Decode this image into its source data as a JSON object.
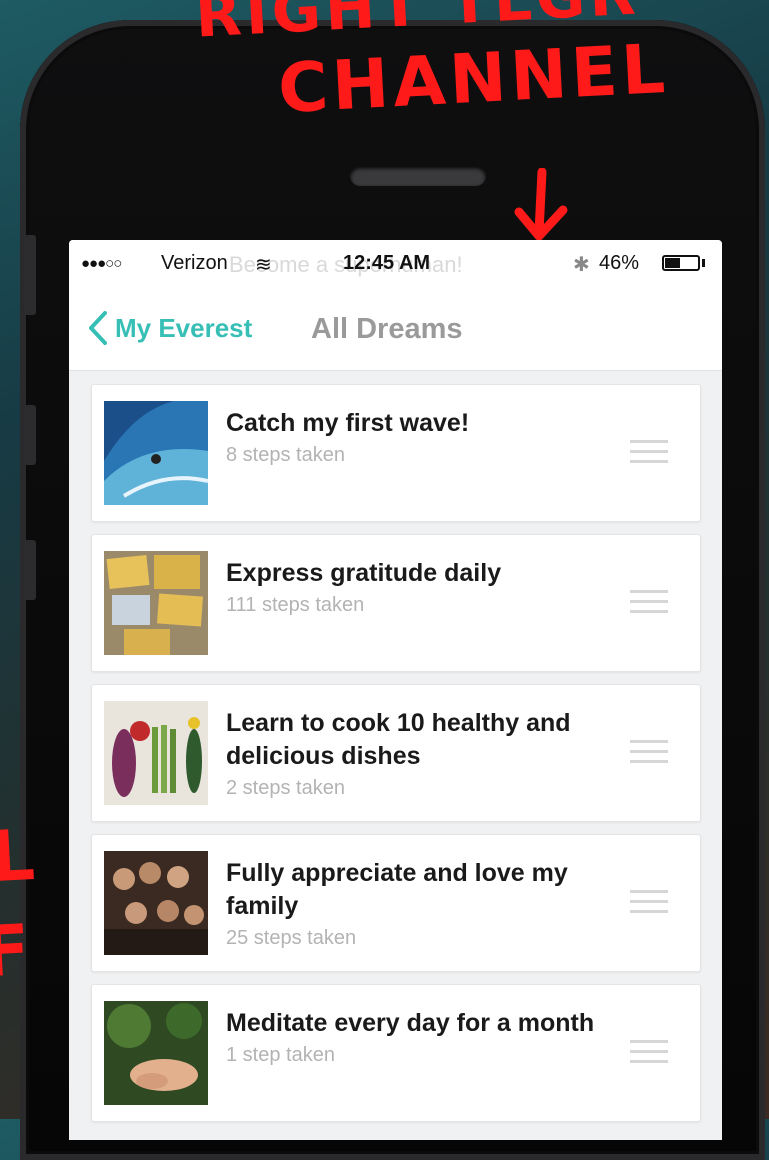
{
  "annotation": {
    "line1": "RIGHT TLGR",
    "line2": "CHANNEL",
    "left_mark_1": "L",
    "left_mark_2": "F",
    "color": "#ff1a1a"
  },
  "status_bar": {
    "signal": "●●●○○",
    "carrier": "Verizon",
    "wifi": "≋",
    "time": "12:45 AM",
    "bluetooth": "✱",
    "battery_percent": "46%",
    "battery_level": 0.46,
    "ghost_text": "Become a superhuman!"
  },
  "nav": {
    "back_label": "My Everest",
    "title": "All Dreams",
    "accent_color": "#37bfb6"
  },
  "dreams": [
    {
      "title": "Catch my first wave!",
      "steps": "8 steps taken",
      "image": "surfing-wave"
    },
    {
      "title": "Express gratitude daily",
      "steps": "111 steps taken",
      "image": "gratitude-notes"
    },
    {
      "title": "Learn to cook 10 healthy and delicious dishes",
      "steps": "2 steps taken",
      "image": "vegetables"
    },
    {
      "title": "Fully appreciate and love my family",
      "steps": "25 steps taken",
      "image": "family-photo"
    },
    {
      "title": "Meditate every day for a month",
      "steps": "1 step taken",
      "image": "meditation-hands"
    }
  ]
}
